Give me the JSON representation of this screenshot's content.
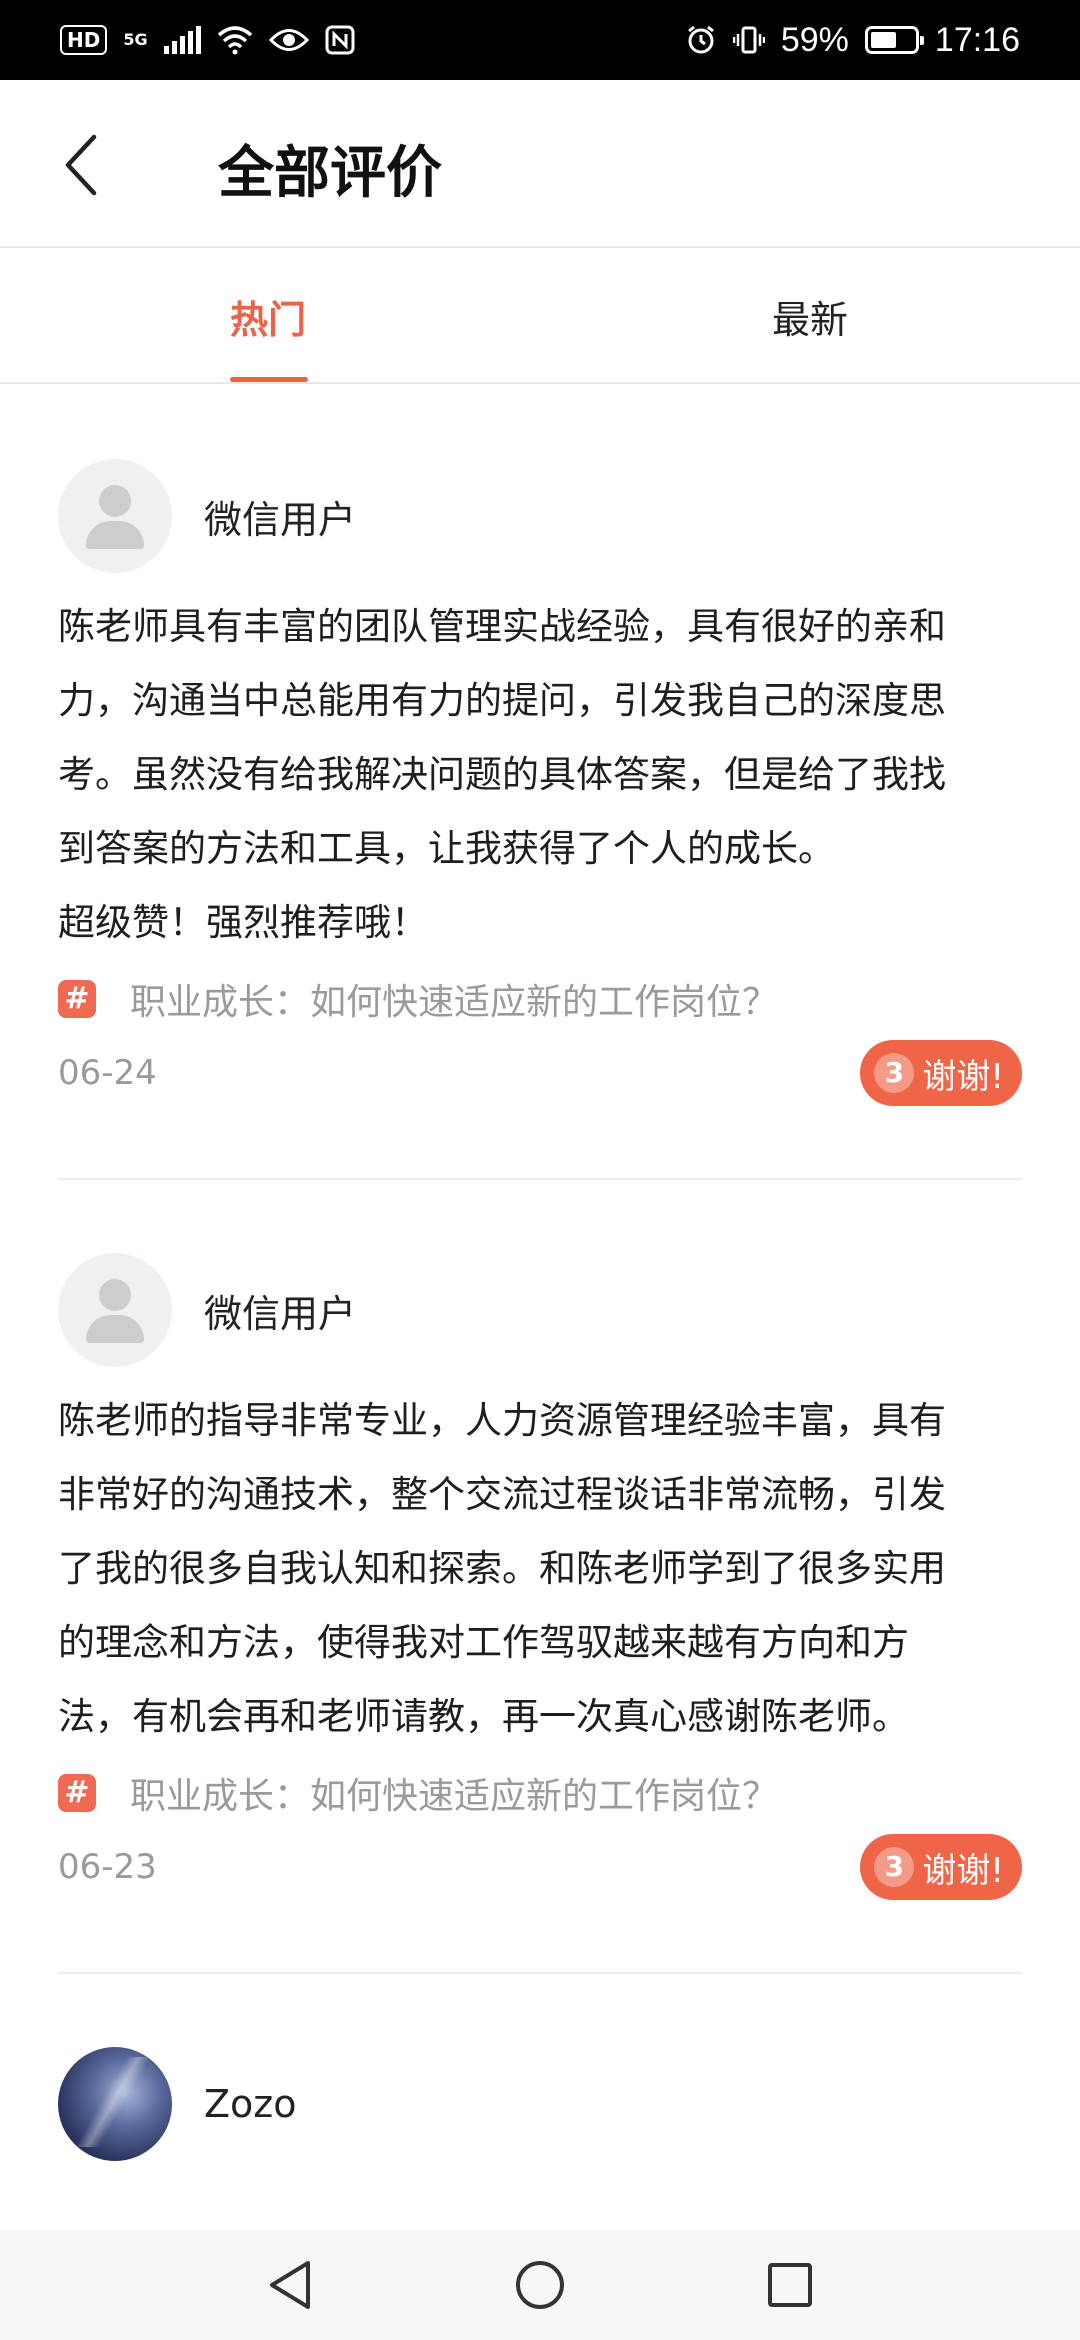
{
  "status_bar": {
    "hd": "HD",
    "network": "5G",
    "battery": "59%",
    "time": "17:16",
    "battery_level": 0.59
  },
  "header": {
    "title": "全部评价",
    "back_icon": "chevron-left-icon"
  },
  "tabs": [
    {
      "label": "热门",
      "active": true
    },
    {
      "label": "最新",
      "active": false
    }
  ],
  "reviews": [
    {
      "user": "微信用户",
      "avatar": "default-avatar-icon",
      "content": "陈老师具有丰富的团队管理实战经验，具有很好的亲和\n力，沟通当中总能用有力的提问，引发我自己的深度思\n考。虽然没有给我解决问题的具体答案，但是给了我找\n到答案的方法和工具，让我获得了个人的成长。\n超级赞！强烈推荐哦！",
      "topic": "职业成长：如何快速适应新的工作岗位？",
      "date": "06-24",
      "thanks_count": "3",
      "thanks_label": "谢谢!"
    },
    {
      "user": "微信用户",
      "avatar": "default-avatar-icon",
      "content": "陈老师的指导非常专业，人力资源管理经验丰富，具有\n非常好的沟通技术，整个交流过程谈话非常流畅，引发\n了我的很多自我认知和探索。和陈老师学到了很多实用\n的理念和方法，使得我对工作驾驭越来越有方向和方\n法，有机会再和老师请教，再一次真心感谢陈老师。",
      "topic": "职业成长：如何快速适应新的工作岗位？",
      "date": "06-23",
      "thanks_count": "3",
      "thanks_label": "谢谢!"
    },
    {
      "user": "Zozo",
      "avatar": "photo-avatar"
    }
  ],
  "colors": {
    "accent": "#e8644a",
    "thanks_button": "#f06448",
    "muted_text": "#9a9a9a"
  },
  "nav_bar": [
    "back-triangle-icon",
    "home-circle-icon",
    "recents-square-icon"
  ]
}
